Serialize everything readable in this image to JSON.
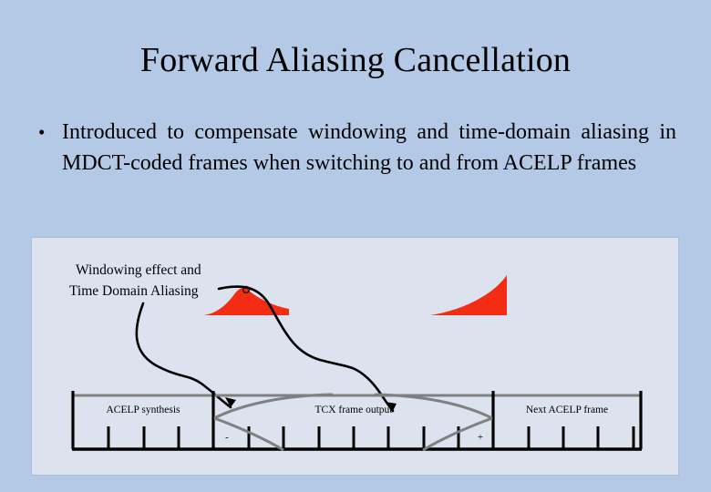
{
  "slide": {
    "title": "Forward Aliasing Cancellation",
    "background_color": "#b3c9e6",
    "bullets": [
      {
        "marker": "•",
        "text": "Introduced to compensate windowing and time-domain aliasing in MDCT-coded frames when switching to and from ACELP frames"
      }
    ]
  },
  "diagram": {
    "panel_background_color": "#dce3ef",
    "panel_border_color": "#a8bcd8",
    "annotation": {
      "line1": "Windowing effect and",
      "line2": "Time Domain Aliasing"
    },
    "aliasing_shape_color": "#f32c14",
    "curve_color": "#808080",
    "arrow_color": "#000000",
    "frames": [
      {
        "label": "ACELP synthesis",
        "ticks": 4
      },
      {
        "label": "TCX frame output",
        "ticks": 8
      },
      {
        "label": "Next ACELP frame",
        "ticks": 4
      }
    ],
    "signs": [
      {
        "symbol": "-",
        "position": "tcx-left"
      },
      {
        "symbol": "+",
        "position": "tcx-right"
      }
    ]
  }
}
